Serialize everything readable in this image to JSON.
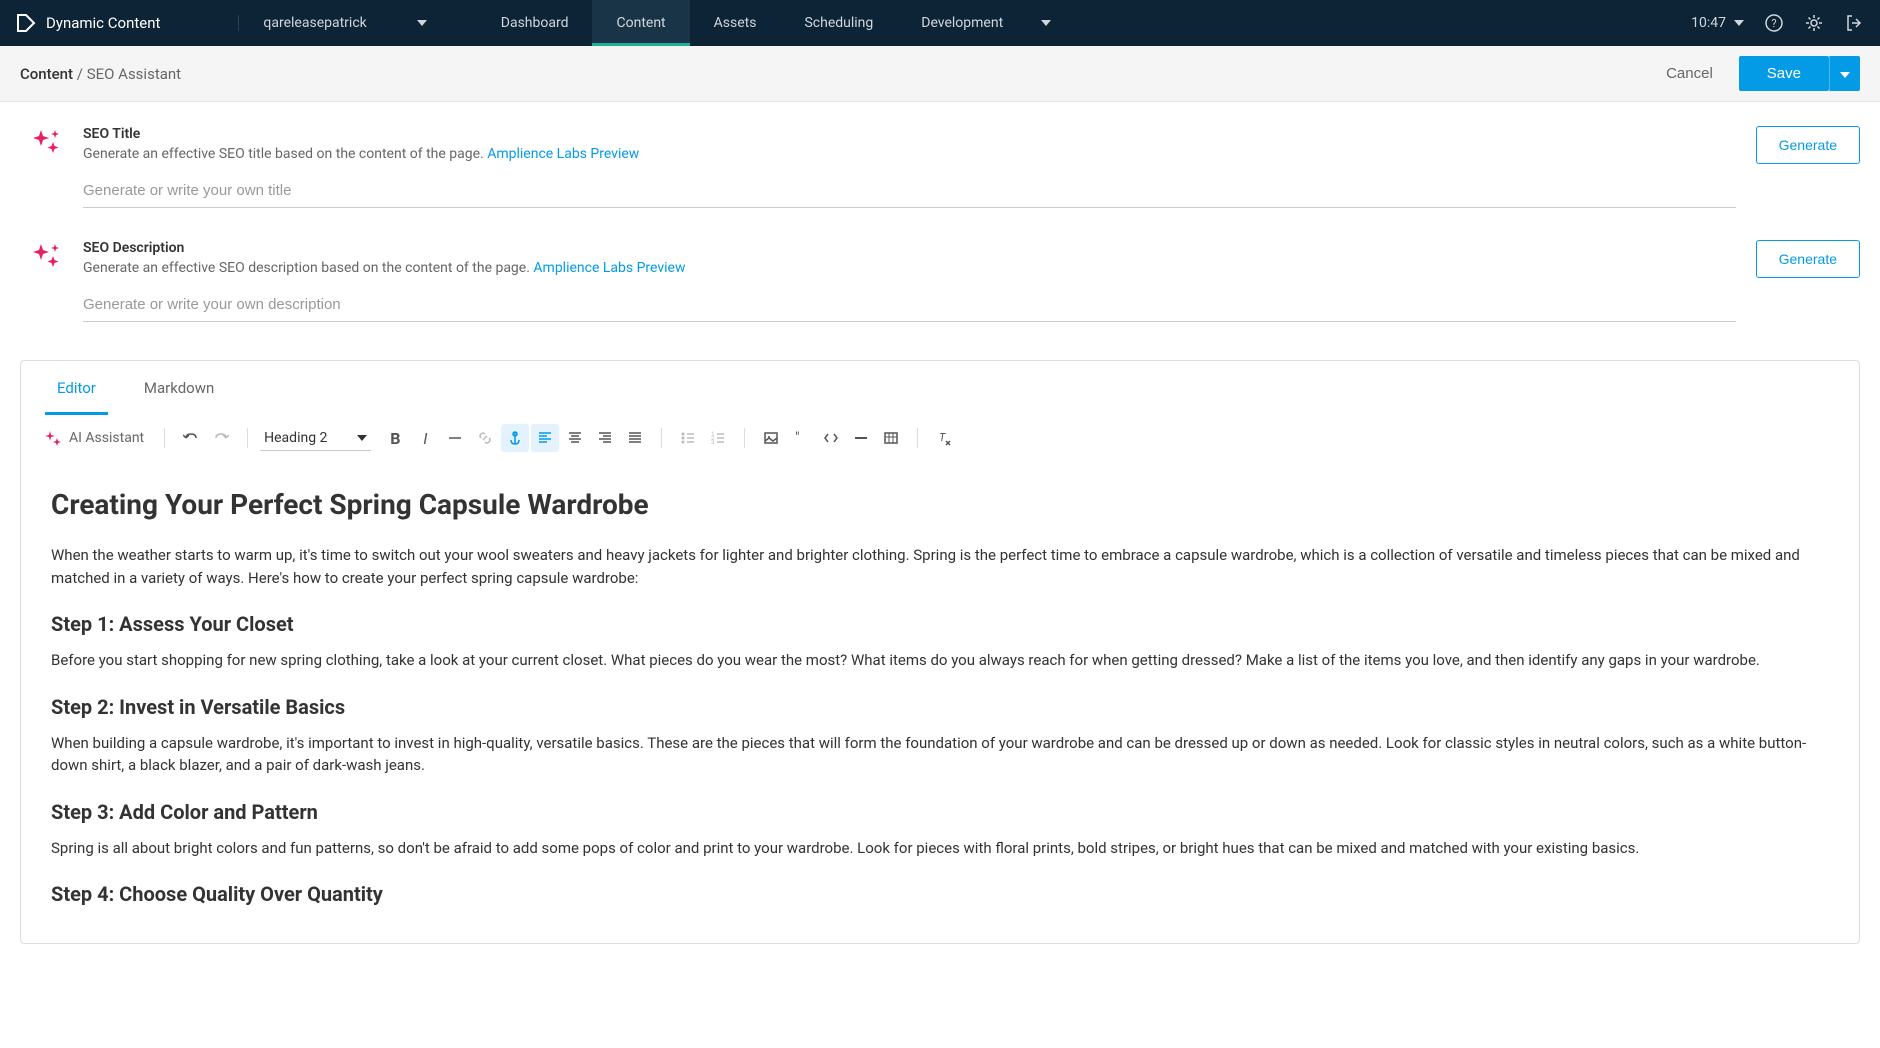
{
  "topnav": {
    "brand": "Dynamic Content",
    "org": "qareleasepatrick",
    "tabs": [
      "Dashboard",
      "Content",
      "Assets",
      "Scheduling",
      "Development"
    ],
    "active_tab": "Content",
    "time": "10:47"
  },
  "breadcrumb": {
    "root": "Content",
    "current": "SEO Assistant",
    "cancel": "Cancel",
    "save": "Save"
  },
  "seo_title": {
    "label": "SEO Title",
    "desc": "Generate an effective SEO title based on the content of the page.",
    "link": "Amplience Labs Preview",
    "placeholder": "Generate or write your own title",
    "button": "Generate"
  },
  "seo_description": {
    "label": "SEO Description",
    "desc": "Generate an effective SEO description based on the content of the page.",
    "link": "Amplience Labs Preview",
    "placeholder": "Generate or write your own description",
    "button": "Generate"
  },
  "editor_tabs": {
    "editor": "Editor",
    "markdown": "Markdown"
  },
  "toolbar": {
    "ai_assistant": "AI Assistant",
    "heading": "Heading 2"
  },
  "content": {
    "h1": "Creating Your Perfect Spring Capsule Wardrobe",
    "p1": "When the weather starts to warm up, it's time to switch out your wool sweaters and heavy jackets for lighter and brighter clothing. Spring is the perfect time to embrace a capsule wardrobe, which is a collection of versatile and timeless pieces that can be mixed and matched in a variety of ways. Here's how to create your perfect spring capsule wardrobe:",
    "h2_1": "Step 1: Assess Your Closet",
    "p2": "Before you start shopping for new spring clothing, take a look at your current closet. What pieces do you wear the most? What items do you always reach for when getting dressed? Make a list of the items you love, and then identify any gaps in your wardrobe.",
    "h2_2": "Step 2: Invest in Versatile Basics",
    "p3": "When building a capsule wardrobe, it's important to invest in high-quality, versatile basics. These are the pieces that will form the foundation of your wardrobe and can be dressed up or down as needed. Look for classic styles in neutral colors, such as a white button-down shirt, a black blazer, and a pair of dark-wash jeans.",
    "h2_3": "Step 3: Add Color and Pattern",
    "p4": "Spring is all about bright colors and fun patterns, so don't be afraid to add some pops of color and print to your wardrobe. Look for pieces with floral prints, bold stripes, or bright hues that can be mixed and matched with your existing basics.",
    "h2_4": "Step 4: Choose Quality Over Quantity"
  }
}
